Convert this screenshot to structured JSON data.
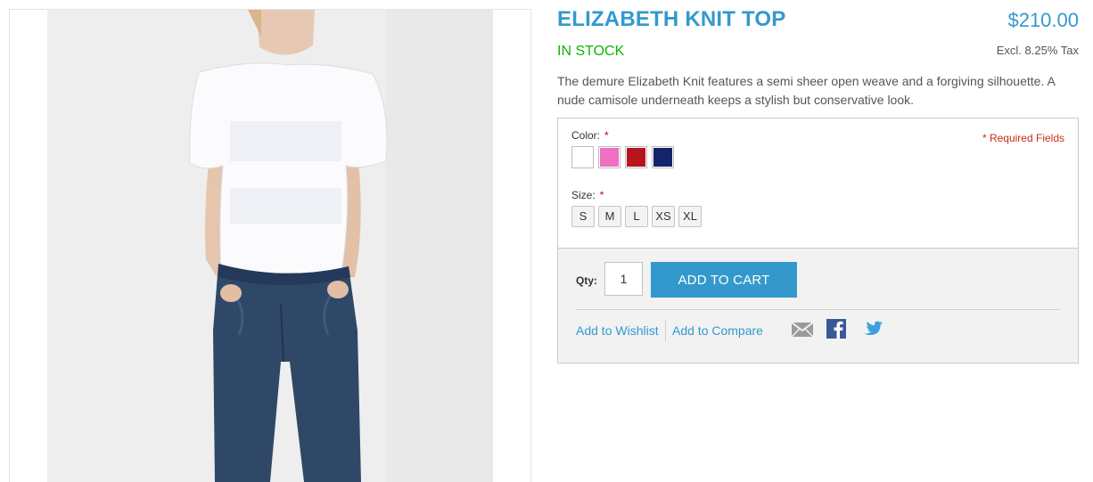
{
  "product": {
    "title": "ELIZABETH KNIT TOP",
    "price": "$210.00",
    "stock": "IN STOCK",
    "tax_note": "Excl. 8.25% Tax",
    "description": "The demure Elizabeth Knit features a semi sheer open weave and a forgiving silhouette. A nude camisole underneath keeps a stylish but conservative look."
  },
  "options": {
    "required_note": "* Required Fields",
    "color_label": "Color:",
    "size_label": "Size:",
    "required_marker": "*",
    "colors": [
      "#ffffff",
      "#ef6fc0",
      "#b8141f",
      "#14246a"
    ],
    "sizes": [
      "S",
      "M",
      "L",
      "XS",
      "XL"
    ]
  },
  "cart": {
    "qty_label": "Qty:",
    "qty_value": "1",
    "add_to_cart": "ADD TO CART",
    "wishlist": "Add to Wishlist",
    "compare": "Add to Compare"
  },
  "icons": [
    "mail-icon",
    "facebook-icon",
    "twitter-icon"
  ]
}
